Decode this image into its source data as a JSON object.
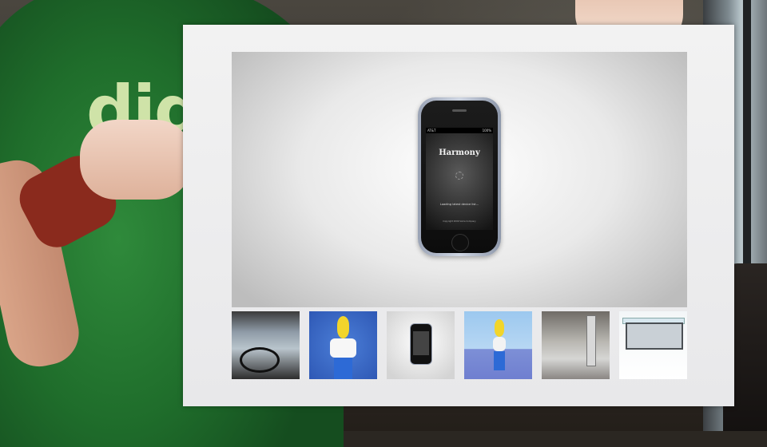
{
  "phone": {
    "app_title": "Harmony",
    "loading_text": "Loading latest device list...",
    "footer_text": "Copyright 2009 Some Company",
    "status_left": "AT&T",
    "status_right": "100%"
  },
  "thumbnails": [
    {
      "label": "car-interior"
    },
    {
      "label": "yellow-character-on-blue"
    },
    {
      "label": "iphone-harmony"
    },
    {
      "label": "walking-character"
    },
    {
      "label": "rocket-launch"
    },
    {
      "label": "house-model"
    }
  ],
  "shirt_logo": "dig"
}
